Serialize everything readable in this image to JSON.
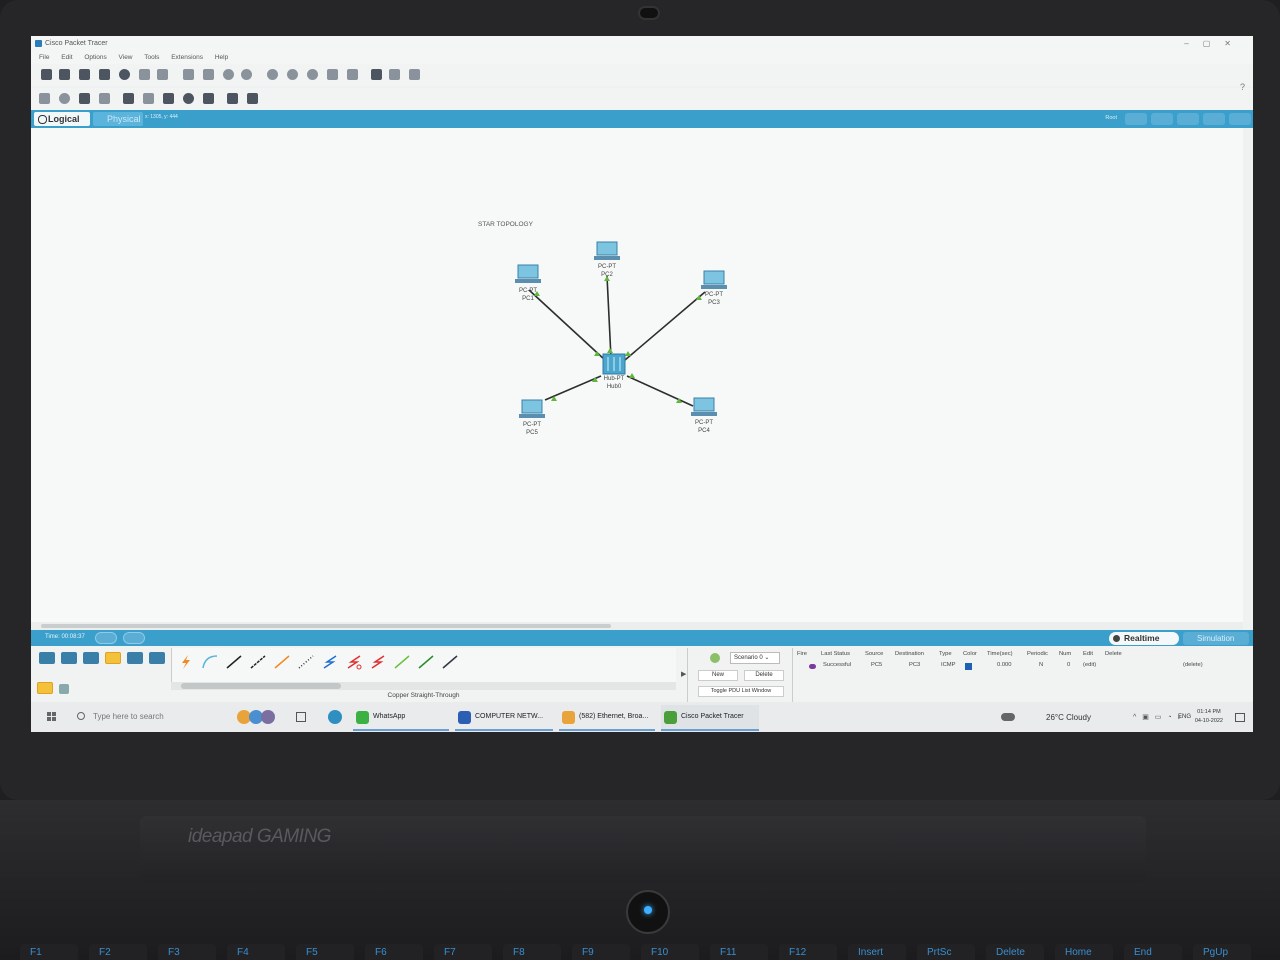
{
  "window": {
    "title": "Cisco Packet Tracer",
    "menu": [
      "File",
      "Edit",
      "Options",
      "View",
      "Tools",
      "Extensions",
      "Help"
    ],
    "help_label": "?"
  },
  "workspace_bar": {
    "logical_label": "Logical",
    "physical_label": "Physical",
    "coords": "x: 1305, y: 444",
    "root_label": "Root"
  },
  "topology": {
    "title": "STAR TOPOLOGY",
    "hub": {
      "type": "Hub-PT",
      "name": "Hub0"
    },
    "devices": [
      {
        "type": "PC-PT",
        "name": "PC1"
      },
      {
        "type": "PC-PT",
        "name": "PC2"
      },
      {
        "type": "PC-PT",
        "name": "PC3"
      },
      {
        "type": "PC-PT",
        "name": "PC4"
      },
      {
        "type": "PC-PT",
        "name": "PC5"
      }
    ],
    "link_color": "#2d2d2d",
    "port_up_color": "#5fb83a"
  },
  "timebar": {
    "time_label": "Time: 00:08:37",
    "realtime_label": "Realtime",
    "simulation_label": "Simulation"
  },
  "bottom": {
    "connection_name": "Copper Straight-Through",
    "scenario_value": "Scenario 0",
    "new_label": "New",
    "delete_label": "Delete",
    "toggle_pdu_label": "Toggle PDU List Window",
    "pdu_headers": [
      "Fire",
      "Last Status",
      "Source",
      "Destination",
      "Type",
      "Color",
      "Time(sec)",
      "Periodic",
      "Num",
      "Edit",
      "Delete"
    ],
    "pdu_row": {
      "last_status": "Successful",
      "source": "PC5",
      "destination": "PC3",
      "type": "ICMP",
      "time": "0.000",
      "periodic": "N",
      "num": "0",
      "edit": "(edit)",
      "delete": "(delete)"
    },
    "pdu_color": "#1f5fb4"
  },
  "taskbar": {
    "search_placeholder": "Type here to search",
    "tasks": [
      {
        "label": "WhatsApp",
        "icon_color": "#3cb043"
      },
      {
        "label": "COMPUTER NETW...",
        "icon_color": "#2b5fb3"
      },
      {
        "label": "(582) Ethernet, Broa...",
        "icon_color": "#e8a33a"
      },
      {
        "label": "Cisco Packet Tracer",
        "icon_color": "#4a9f3a"
      }
    ],
    "weather": "26°C  Cloudy",
    "language": "ENG",
    "time": "01:14 PM",
    "date": "04-10-2022"
  },
  "laptop": {
    "brand": "ideapad GAMING",
    "keys": [
      "F1",
      "F2",
      "F3",
      "F4",
      "F5",
      "F6",
      "F7",
      "F8",
      "F9",
      "F10",
      "F11",
      "F12",
      "Insert",
      "PrtSc",
      "Delete",
      "Home",
      "End",
      "PgUp"
    ]
  }
}
